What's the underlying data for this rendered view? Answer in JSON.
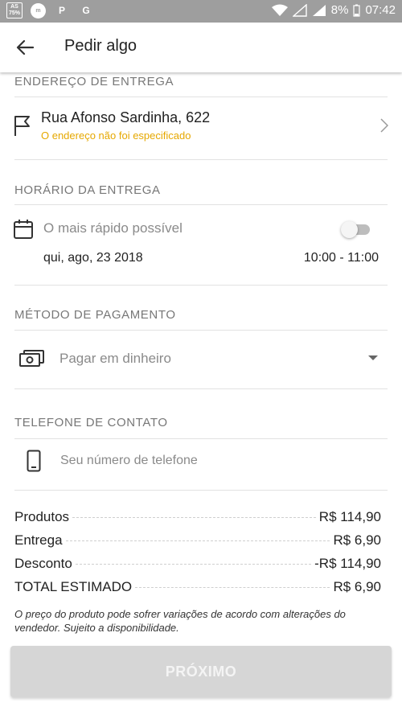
{
  "status_bar": {
    "left_icons": [
      "AS 75%",
      "m",
      "P",
      "G"
    ],
    "battery": "8%",
    "time": "07:42"
  },
  "header": {
    "title": "Pedir algo",
    "back_icon": "arrow-left-icon"
  },
  "delivery_address": {
    "section_label": "ENDEREÇO DE ENTREGA",
    "street": "Rua Afonso Sardinha, 622",
    "warning": "O endereço não foi especificado"
  },
  "delivery_time": {
    "section_label": "HORÁRIO DA ENTREGA",
    "asap_label": "O mais rápido possível",
    "asap_enabled": false,
    "date": "qui, ago, 23 2018",
    "time_range": "10:00 - 11:00"
  },
  "payment": {
    "section_label": "MÉTODO DE PAGAMENTO",
    "selected": "Pagar em dinheiro"
  },
  "contact": {
    "section_label": "TELEFONE DE CONTATO",
    "phone_placeholder": "Seu número de telefone",
    "phone_value": ""
  },
  "summary": {
    "rows": [
      {
        "label": "Produtos",
        "value": "R$ 114,90"
      },
      {
        "label": "Entrega",
        "value": "R$ 6,90"
      },
      {
        "label": "Desconto",
        "value": "-R$ 114,90"
      },
      {
        "label": "TOTAL ESTIMADO",
        "value": "R$ 6,90"
      }
    ]
  },
  "disclaimer": "O preço do produto pode sofrer variações de acordo com alterações do vendedor. Sujeito a disponibilidade.",
  "next_button": "PRÓXIMO",
  "colors": {
    "status_bar": "#9e9e9e",
    "warning": "#e6a800",
    "button_disabled": "#d6d6d6"
  }
}
